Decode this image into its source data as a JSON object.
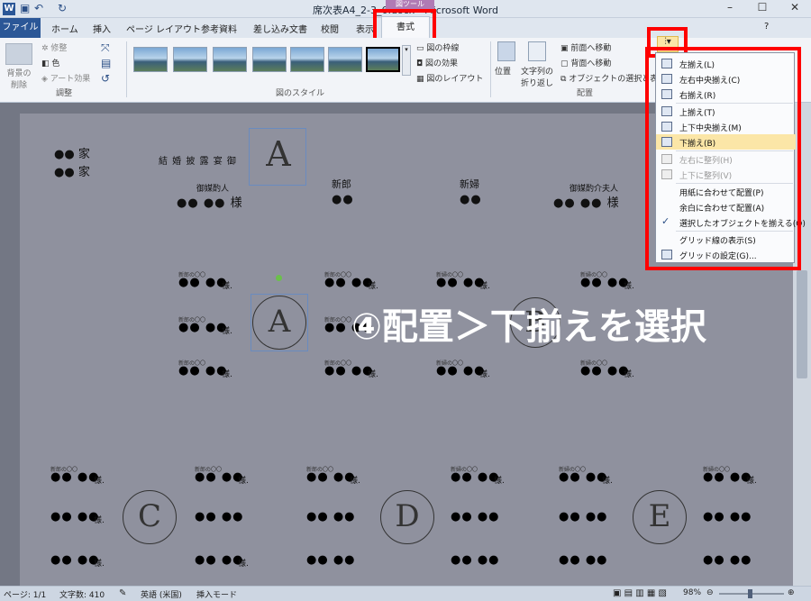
{
  "window": {
    "title": "席次表A4_2-3_6.docx - Microsoft Word",
    "app_icon": "W",
    "context_tab": "図ツール"
  },
  "tabs": [
    "ファイル",
    "ホーム",
    "挿入",
    "ページ レイアウト",
    "参考資料",
    "差し込み文書",
    "校閲",
    "表示",
    "書式"
  ],
  "ribbon": {
    "adjust": {
      "remove_bg": "背景の\n削除",
      "corrections": "修整",
      "color": "色",
      "artistic": "アート効果",
      "group": "調整"
    },
    "styles": {
      "border": "図の枠線",
      "effects": "図の効果",
      "layout": "図のレイアウト",
      "group": "図のスタイル"
    },
    "arrange": {
      "position": "位置",
      "wrap": "文字列の\n折り返し",
      "bring_forward": "前面へ移動",
      "send_backward": "背面へ移動",
      "selection_pane": "オブジェクトの選択と表示",
      "group": "配置"
    }
  },
  "align_menu": {
    "items": [
      {
        "label": "左揃え(L)",
        "icon": "align-left-icon",
        "disabled": false
      },
      {
        "label": "左右中央揃え(C)",
        "icon": "align-center-icon",
        "disabled": false
      },
      {
        "label": "右揃え(R)",
        "icon": "align-right-icon",
        "disabled": false
      },
      {
        "label": "上揃え(T)",
        "icon": "align-top-icon",
        "disabled": false
      },
      {
        "label": "上下中央揃え(M)",
        "icon": "align-middle-icon",
        "disabled": false
      },
      {
        "label": "下揃え(B)",
        "icon": "align-bottom-icon",
        "disabled": false,
        "highlighted": true
      },
      {
        "label": "左右に整列(H)",
        "icon": "distribute-horizontal-icon",
        "disabled": true
      },
      {
        "label": "上下に整列(V)",
        "icon": "distribute-vertical-icon",
        "disabled": true
      },
      {
        "label": "用紙に合わせて配置(P)",
        "disabled": false
      },
      {
        "label": "余白に合わせて配置(A)",
        "disabled": false
      },
      {
        "label": "選択したオブジェクトを揃える(O)",
        "disabled": false,
        "checked": true
      },
      {
        "label": "グリッド線の表示(S)",
        "disabled": false
      },
      {
        "label": "グリッドの設定(G)...",
        "icon": "grid-settings-icon",
        "disabled": false
      }
    ]
  },
  "document": {
    "family1": "●● 家",
    "family2": "●● 家",
    "heading": "結 婚 披 露 宴 御",
    "head_table": {
      "left_role": "御媒酌人",
      "left_names": "●●  ●● 様",
      "groom": "新郎",
      "groom_name": "●●",
      "bride": "新婦",
      "bride_name": "●●",
      "right_role": "御媒酌介夫人",
      "right_names": "●●  ●● 様"
    },
    "guest_caption": "新郎の〇〇",
    "guest_caption_bride": "新婦の〇〇",
    "guest_name": "●● ●●",
    "sama": "様.",
    "tables": [
      "A",
      "B",
      "C",
      "D",
      "E"
    ]
  },
  "annotation": "④配置＞下揃えを選択",
  "status": {
    "page": "ページ: 1/1",
    "words": "文字数: 410",
    "language": "英語 (米国)",
    "mode": "挿入モード",
    "zoom": "98%"
  },
  "colors": {
    "highlight": "#ff0000",
    "file_tab": "#2b5797",
    "menu_highlight": "#fbe6a7"
  }
}
